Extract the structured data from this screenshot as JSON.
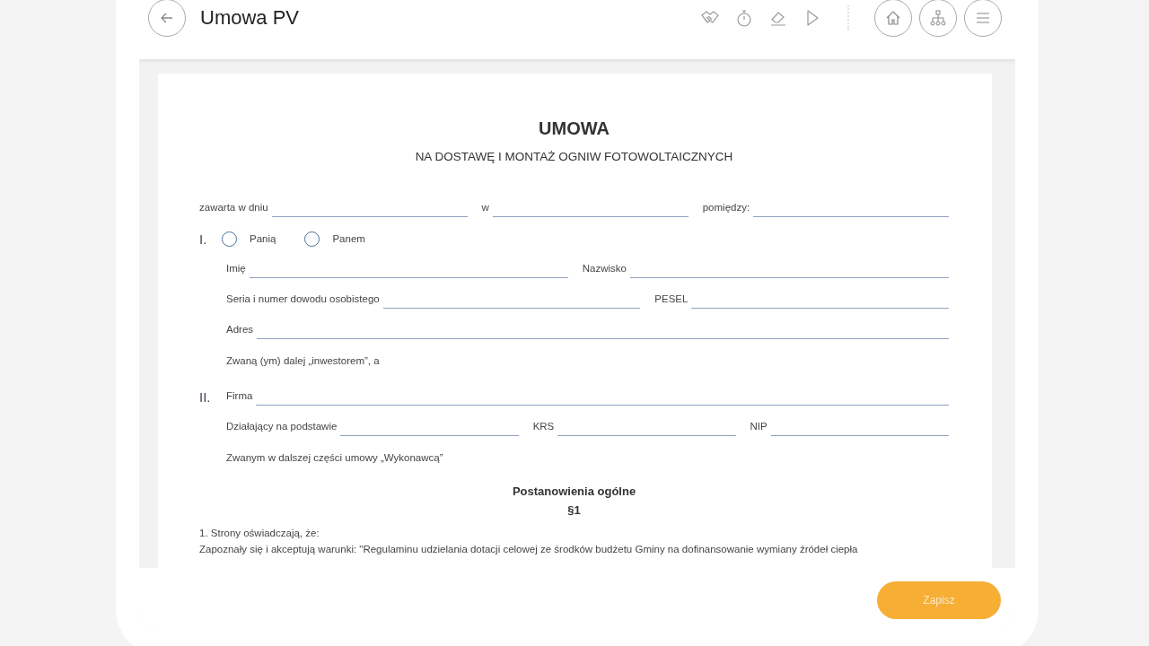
{
  "header": {
    "title": "Umowa PV"
  },
  "document": {
    "title": "UMOWA",
    "subtitle": "NA DOSTAWĘ I MONTAŻ OGNIW FOTOWOLTAICZNYCH",
    "blocks": [
      {
        "kind": "fields",
        "items": [
          {
            "label": "zawarta w dniu"
          },
          {
            "label": "w"
          },
          {
            "label": "pomiędzy:"
          }
        ]
      },
      {
        "kind": "section",
        "marker": "I.",
        "children": [
          {
            "kind": "radios",
            "options": [
              {
                "label": "Panią",
                "selected": false
              },
              {
                "label": "Panem",
                "selected": false
              }
            ]
          },
          {
            "kind": "fields",
            "items": [
              {
                "label": "Imię"
              },
              {
                "label": "Nazwisko"
              }
            ]
          },
          {
            "kind": "fields",
            "items": [
              {
                "label": "Seria i numer dowodu osobistego"
              },
              {
                "label": "PESEL"
              }
            ]
          },
          {
            "kind": "fields",
            "items": [
              {
                "label": "Adres"
              }
            ]
          },
          {
            "kind": "text",
            "text": "Zwaną (ym) dalej „inwestorem”, a"
          }
        ]
      },
      {
        "kind": "section",
        "marker": "II.",
        "children": [
          {
            "kind": "fields",
            "items": [
              {
                "label": "Firma"
              }
            ]
          },
          {
            "kind": "fields",
            "items": [
              {
                "label": "Działający na podstawie"
              },
              {
                "label": "KRS"
              },
              {
                "label": "NIP"
              }
            ]
          },
          {
            "kind": "text",
            "text": "Zwanym w dalszej części umowy „Wykonawcą”"
          }
        ]
      },
      {
        "kind": "heading",
        "text": "Postanowienia ogólne"
      },
      {
        "kind": "heading",
        "text": "§1"
      },
      {
        "kind": "paragraph",
        "text": "1. Strony oświadczają, że:"
      },
      {
        "kind": "paragraph",
        "text": "Zapoznały się i akceptują warunki: \"Regulaminu udzielania dotacji celowej ze środków budżetu Gminy na dofinansowanie wymiany źródeł ciepła"
      }
    ]
  },
  "footer": {
    "button": "Zapisz"
  }
}
